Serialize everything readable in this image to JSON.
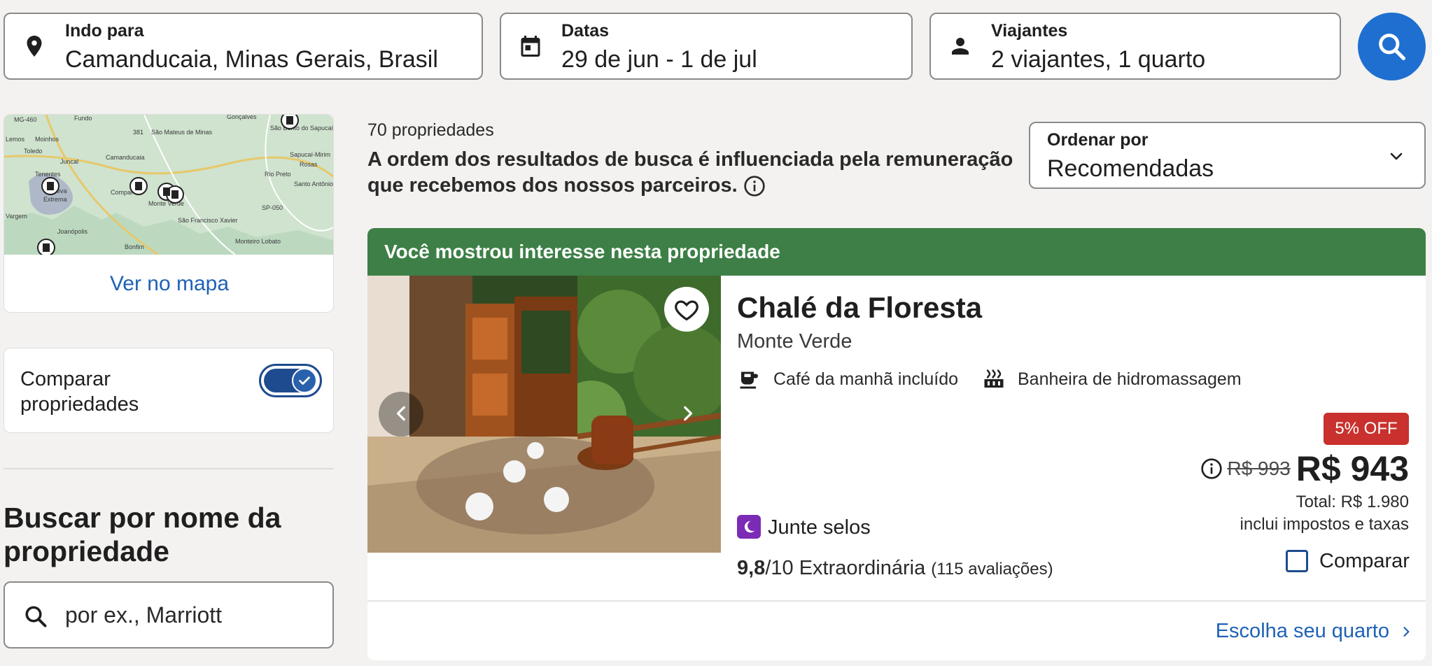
{
  "search": {
    "destination": {
      "label": "Indo para",
      "value": "Camanducaia, Minas Gerais, Brasil",
      "icon": "location-pin-icon"
    },
    "dates": {
      "label": "Datas",
      "value": "29 de jun - 1 de jul",
      "icon": "calendar-icon"
    },
    "travelers": {
      "label": "Viajantes",
      "value": "2 viajantes, 1 quarto",
      "icon": "person-icon"
    },
    "button_icon": "search-icon",
    "button_color": "#1f6fd0"
  },
  "sidebar": {
    "map": {
      "link": "Ver no mapa",
      "places": [
        "Gonçalves",
        "Fundo",
        "São Mateus de Minas",
        "São Bento do Sapucaí",
        "Lemos",
        "Moinhos",
        "Toledo",
        "Juncal",
        "Camanducaia",
        "Sapucaí-Mirim",
        "Rosas",
        "Tenentes",
        "Itapeva",
        "Extrema",
        "Compar",
        "Monte Verde",
        "Rio Preto",
        "Santo Antônio do Pinhal",
        "Vargem",
        "Joanópolis",
        "São Francisco Xavier",
        "Bonfim",
        "Monteiro Lobato"
      ],
      "road_labels": [
        "MG-460",
        "381",
        "SP-050"
      ]
    },
    "compare": {
      "label": "Comparar propriedades",
      "enabled": true
    },
    "name_search": {
      "heading": "Buscar por nome da propriedade",
      "placeholder": "por ex., Marriott",
      "icon": "search-icon"
    }
  },
  "results": {
    "count_text": "70 propriedades",
    "disclaimer": "A ordem dos resultados de busca é influenciada pela remuneração que recebemos dos nossos parceiros.",
    "sort": {
      "label": "Ordenar por",
      "value": "Recomendadas"
    }
  },
  "listing": {
    "banner": "Você mostrou interesse nesta propriedade",
    "banner_color": "#3d7f46",
    "name": "Chalé da Floresta",
    "location": "Monte Verde",
    "amenities": [
      {
        "icon": "coffee-cup-icon",
        "label": "Café da manhã incluído"
      },
      {
        "icon": "hot-tub-icon",
        "label": "Banheira de hidromassagem"
      }
    ],
    "discount_badge": "5% OFF",
    "discount_color": "#c8312d",
    "old_price": "R$ 993",
    "price": "R$ 943",
    "total": "Total: R$ 1.980",
    "taxes_note": "inclui impostos e taxas",
    "stamps": "Junte selos",
    "rating_score": "9,8",
    "rating_scale": "/10 Extraordinária",
    "reviews": "(115 avaliações)",
    "compare_label": "Comparar",
    "compare_checked": false,
    "cta": "Escolha seu quarto",
    "favorite_icon": "heart-icon"
  }
}
